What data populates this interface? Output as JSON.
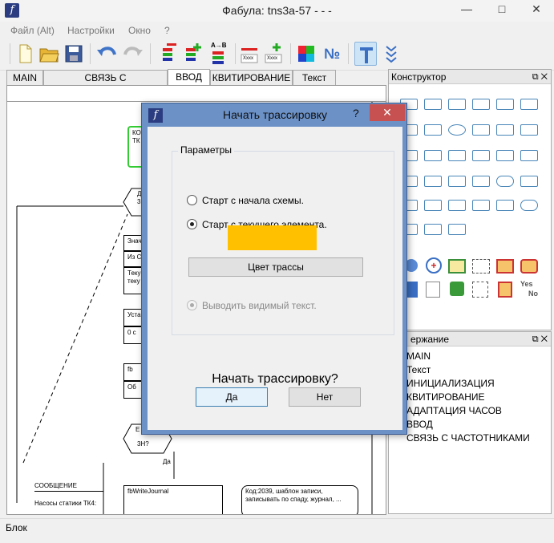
{
  "window": {
    "title": "Фабула: tns3a-57 - - -",
    "minimize": "—",
    "maximize": "□",
    "close": "✕"
  },
  "menu": [
    "Файл (Alt)",
    "Настройки",
    "Окно",
    "?"
  ],
  "toolbar_icons": [
    "new-file-icon",
    "open-folder-icon",
    "save-icon",
    "undo-icon",
    "redo-icon",
    "remove-stack-icon",
    "add-stack-icon",
    "sort-ab-icon",
    "remove-cell-icon",
    "add-cell-icon",
    "color-palette-icon",
    "number-icon",
    "text-t-icon",
    "expand-down-icon"
  ],
  "toolbar_labels": {
    "sort": "A→B",
    "cell_text": "Xxxx",
    "number": "№"
  },
  "tabs": [
    "MAIN",
    "СВЯЗЬ С ЧАСТОТНИКАМИ",
    "ВВОД",
    "КВИТИРОВАНИЕ",
    "Текст"
  ],
  "active_tab": "ВВОД",
  "canvas": {
    "nodes": [
      "КО ТК",
      "Д у 3",
      "Знач",
      "Из С",
      "Теку теку",
      "Уста",
      "0 с",
      "fb",
      "Об",
      "Е",
      "3Н?",
      "Да",
      "СООБЩЕНИЕ",
      "Насосы статики ТК4:",
      "fbWriteJournal",
      "Код:2039, шаблон записи, записывать по спаду, журнал, ..."
    ]
  },
  "constructor": {
    "title": "Конструктор",
    "yes": "Yes",
    "no": "No"
  },
  "content": {
    "title": "Содержание",
    "title_visible": "ержание",
    "items": [
      "MAIN",
      "Текст",
      "ИНИЦИАЛИЗАЦИЯ",
      "КВИТИРОВАНИЕ",
      "АДАПТАЦИЯ ЧАСОВ",
      "ВВОД",
      "СВЯЗЬ С ЧАСТОТНИКАМИ"
    ]
  },
  "status": "Блок",
  "dialog": {
    "title": "Начать трассировку",
    "help": "?",
    "close": "✕",
    "group_label": "Параметры",
    "radio_start_scheme": "Старт с начала схемы.",
    "radio_start_current": "Старт с текущего элемента.",
    "selected": "start_current",
    "trace_color": "#ffc000",
    "color_button": "Цвет трассы",
    "show_text_label": "Выводить видимый текст.",
    "question": "Начать трассировку?",
    "yes_button": "Да",
    "no_button": "Нет"
  }
}
